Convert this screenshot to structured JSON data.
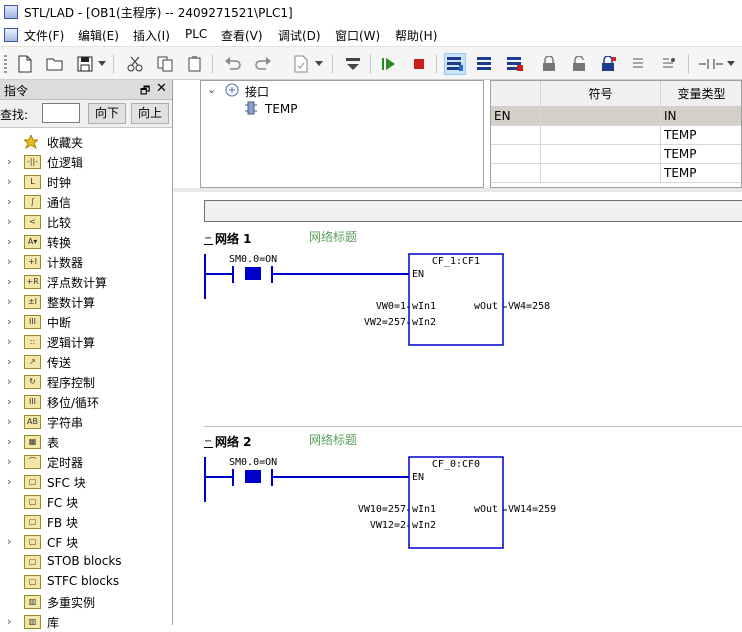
{
  "window": {
    "title": "STL/LAD - [OB1(主程序) -- 2409271521\\PLC1]"
  },
  "menu": [
    {
      "label": "文件(F)"
    },
    {
      "label": "编辑(E)"
    },
    {
      "label": "插入(I)"
    },
    {
      "label": "PLC"
    },
    {
      "label": "查看(V)"
    },
    {
      "label": "调试(D)"
    },
    {
      "label": "窗口(W)"
    },
    {
      "label": "帮助(H)"
    }
  ],
  "left_panel": {
    "title": "指令",
    "search_label": "查找:",
    "search_value": "",
    "btn_down": "向下",
    "btn_up": "向上",
    "items": [
      {
        "label": "收藏夹",
        "icon": "star-icon",
        "glyph": "★",
        "expandable": false
      },
      {
        "label": "位逻辑",
        "icon": "bit-logic-icon",
        "glyph": "-||-",
        "expandable": true
      },
      {
        "label": "时钟",
        "icon": "clock-icon",
        "glyph": "L",
        "expandable": true
      },
      {
        "label": "通信",
        "icon": "communication-icon",
        "glyph": "∫",
        "expandable": true
      },
      {
        "label": "比较",
        "icon": "compare-icon",
        "glyph": "<",
        "expandable": true
      },
      {
        "label": "转换",
        "icon": "convert-icon",
        "glyph": "A▾",
        "expandable": true
      },
      {
        "label": "计数器",
        "icon": "counter-icon",
        "glyph": "+I",
        "expandable": true
      },
      {
        "label": "浮点数计算",
        "icon": "float-math-icon",
        "glyph": "+R",
        "expandable": true
      },
      {
        "label": "整数计算",
        "icon": "integer-math-icon",
        "glyph": "±I",
        "expandable": true
      },
      {
        "label": "中断",
        "icon": "interrupt-icon",
        "glyph": "III",
        "expandable": true
      },
      {
        "label": "逻辑计算",
        "icon": "logic-operation-icon",
        "glyph": "::",
        "expandable": true
      },
      {
        "label": "传送",
        "icon": "transfer-icon",
        "glyph": "↗",
        "expandable": true
      },
      {
        "label": "程序控制",
        "icon": "program-control-icon",
        "glyph": "↻",
        "expandable": true
      },
      {
        "label": "移位/循环",
        "icon": "shift-rotate-icon",
        "glyph": "III",
        "expandable": true
      },
      {
        "label": "字符串",
        "icon": "string-icon",
        "glyph": "AB",
        "expandable": true
      },
      {
        "label": "表",
        "icon": "table-icon",
        "glyph": "▦",
        "expandable": true
      },
      {
        "label": "定时器",
        "icon": "timer-icon",
        "glyph": "⌒",
        "expandable": true
      },
      {
        "label": "SFC 块",
        "icon": "sfc-block-icon",
        "glyph": "▢",
        "expandable": true
      },
      {
        "label": "FC 块",
        "icon": "fc-block-icon",
        "glyph": "▢",
        "expandable": false
      },
      {
        "label": "FB 块",
        "icon": "fb-block-icon",
        "glyph": "▢",
        "expandable": false
      },
      {
        "label": "CF 块",
        "icon": "cf-block-icon",
        "glyph": "▢",
        "expandable": true
      },
      {
        "label": "STOB blocks",
        "icon": "stob-block-icon",
        "glyph": "▢",
        "expandable": false
      },
      {
        "label": "STFC blocks",
        "icon": "stfc-block-icon",
        "glyph": "▢",
        "expandable": false
      },
      {
        "label": "多重实例",
        "icon": "multi-instance-icon",
        "glyph": "▥",
        "expandable": false
      },
      {
        "label": "库",
        "icon": "library-icon",
        "glyph": "▥",
        "expandable": true
      }
    ]
  },
  "interface": {
    "root": "接口",
    "child": "TEMP"
  },
  "var_table": {
    "headers": [
      "符号",
      "变量类型"
    ],
    "rows": [
      {
        "symbol": "EN",
        "type": "IN",
        "selected": true
      },
      {
        "symbol": "",
        "type": "TEMP",
        "selected": false
      },
      {
        "symbol": "",
        "type": "TEMP",
        "selected": false
      },
      {
        "symbol": "",
        "type": "TEMP",
        "selected": false
      }
    ]
  },
  "networks": [
    {
      "title": "网络 1",
      "comment": "网络标题",
      "contact": "SM0.0=ON",
      "block": "CF_1:CF1",
      "en": "EN",
      "in1_label": "wIn1",
      "in1_value": "VW0=1",
      "in2_label": "wIn2",
      "in2_value": "VW2=257",
      "out_label": "wOut",
      "out_value": "VW4=258"
    },
    {
      "title": "网络 2",
      "comment": "网络标题",
      "contact": "SM0.0=ON",
      "block": "CF_0:CF0",
      "en": "EN",
      "in1_label": "wIn1",
      "in1_value": "VW10=257",
      "in2_label": "wIn2",
      "in2_value": "VW12=2",
      "out_label": "wOut",
      "out_value": "VW14=259"
    }
  ],
  "colors": {
    "accent_blue": "#0000cc",
    "comment_green": "#5aa05a",
    "selected_row": "#d4d0c8"
  }
}
